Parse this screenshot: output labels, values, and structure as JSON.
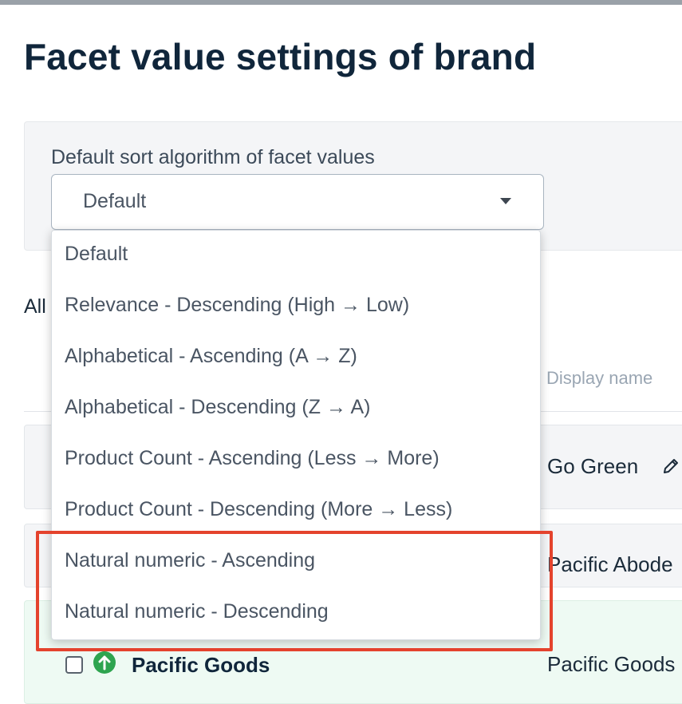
{
  "page": {
    "title": "Facet value settings of brand"
  },
  "sort_settings": {
    "label": "Default sort algorithm of facet values",
    "selected_value": "Default"
  },
  "dropdown": {
    "options": [
      "Default",
      "Relevance - Descending (High → Low)",
      "Alphabetical - Ascending (A → Z)",
      "Alphabetical - Descending (Z → A)",
      "Product Count - Ascending (Less → More)",
      "Product Count - Descending (More → Less)",
      "Natural numeric - Ascending",
      "Natural numeric - Descending"
    ]
  },
  "tabs": {
    "all_label": "All"
  },
  "table": {
    "column_display_name": "Display name",
    "rows": [
      {
        "name": "",
        "display_name": "Go Green"
      },
      {
        "name": "",
        "display_name": "Pacific Abode"
      },
      {
        "name": "Pacific Goods",
        "display_name": "Pacific Goods"
      }
    ]
  },
  "colors": {
    "highlight": "#e4432d",
    "promote": "#2ea44f",
    "title": "#10263b"
  }
}
